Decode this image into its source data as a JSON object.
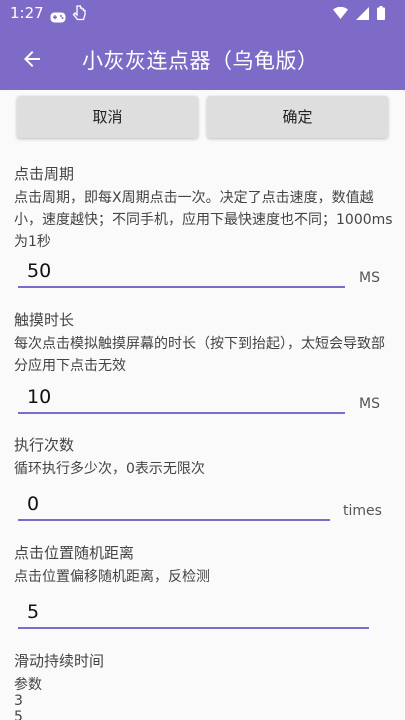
{
  "status": {
    "time": "1:27"
  },
  "app_bar": {
    "title": "小灰灰连点器（乌龟版）"
  },
  "buttons": {
    "cancel": "取消",
    "confirm": "确定"
  },
  "sections": [
    {
      "title": "点击周期",
      "desc": "点击周期，即每X周期点击一次。决定了点击速度，数值越小，速度越快；不同手机，应用下最快速度也不同；1000ms为1秒",
      "value": "50",
      "unit": "MS"
    },
    {
      "title": "触摸时长",
      "desc": "每次点击模拟触摸屏幕的时长（按下到抬起），太短会导致部分应用下点击无效",
      "value": "10",
      "unit": "MS"
    },
    {
      "title": "执行次数",
      "desc": "循环执行多少次，0表示无限次",
      "value": "0",
      "unit": "times"
    },
    {
      "title": "点击位置随机距离",
      "desc": "点击位置偏移随机距离，反检测",
      "value": "5",
      "unit": ""
    },
    {
      "title": "滑动持续时间",
      "desc": "参数",
      "lines": [
        "3",
        "5"
      ]
    }
  ],
  "colors": {
    "primary": "#7e6bc7",
    "background": "#fafafa",
    "button": "#dedede"
  }
}
